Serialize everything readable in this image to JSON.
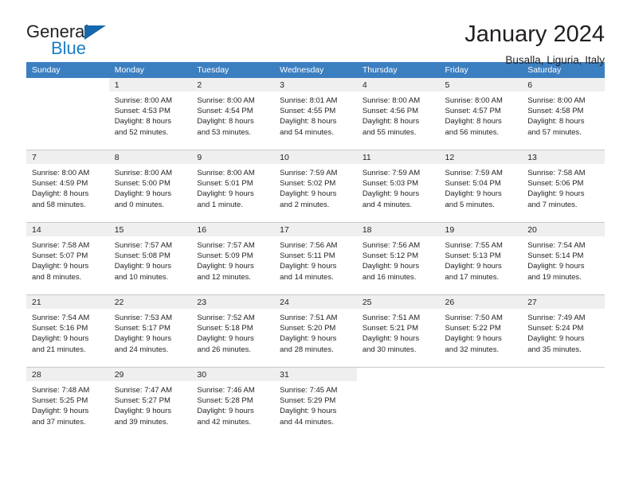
{
  "brand": {
    "name_top": "General",
    "name_bottom": "Blue",
    "triangle_color": "#1568ab",
    "blue_color": "#1b7fc4"
  },
  "header": {
    "title": "January 2024",
    "subtitle": "Busalla, Liguria, Italy"
  },
  "theme": {
    "header_row_bg": "#3c7fc0",
    "header_row_text": "#ffffff",
    "daynum_bg": "#efefef",
    "cell_border": "#c8c8c8",
    "text": "#231f20"
  },
  "weekdays": [
    "Sunday",
    "Monday",
    "Tuesday",
    "Wednesday",
    "Thursday",
    "Friday",
    "Saturday"
  ],
  "weeks": [
    [
      {
        "day": "",
        "sunrise": "",
        "sunset": "",
        "daylight1": "",
        "daylight2": "",
        "blank": true
      },
      {
        "day": "1",
        "sunrise": "Sunrise: 8:00 AM",
        "sunset": "Sunset: 4:53 PM",
        "daylight1": "Daylight: 8 hours",
        "daylight2": "and 52 minutes."
      },
      {
        "day": "2",
        "sunrise": "Sunrise: 8:00 AM",
        "sunset": "Sunset: 4:54 PM",
        "daylight1": "Daylight: 8 hours",
        "daylight2": "and 53 minutes."
      },
      {
        "day": "3",
        "sunrise": "Sunrise: 8:01 AM",
        "sunset": "Sunset: 4:55 PM",
        "daylight1": "Daylight: 8 hours",
        "daylight2": "and 54 minutes."
      },
      {
        "day": "4",
        "sunrise": "Sunrise: 8:00 AM",
        "sunset": "Sunset: 4:56 PM",
        "daylight1": "Daylight: 8 hours",
        "daylight2": "and 55 minutes."
      },
      {
        "day": "5",
        "sunrise": "Sunrise: 8:00 AM",
        "sunset": "Sunset: 4:57 PM",
        "daylight1": "Daylight: 8 hours",
        "daylight2": "and 56 minutes."
      },
      {
        "day": "6",
        "sunrise": "Sunrise: 8:00 AM",
        "sunset": "Sunset: 4:58 PM",
        "daylight1": "Daylight: 8 hours",
        "daylight2": "and 57 minutes."
      }
    ],
    [
      {
        "day": "7",
        "sunrise": "Sunrise: 8:00 AM",
        "sunset": "Sunset: 4:59 PM",
        "daylight1": "Daylight: 8 hours",
        "daylight2": "and 58 minutes."
      },
      {
        "day": "8",
        "sunrise": "Sunrise: 8:00 AM",
        "sunset": "Sunset: 5:00 PM",
        "daylight1": "Daylight: 9 hours",
        "daylight2": "and 0 minutes."
      },
      {
        "day": "9",
        "sunrise": "Sunrise: 8:00 AM",
        "sunset": "Sunset: 5:01 PM",
        "daylight1": "Daylight: 9 hours",
        "daylight2": "and 1 minute."
      },
      {
        "day": "10",
        "sunrise": "Sunrise: 7:59 AM",
        "sunset": "Sunset: 5:02 PM",
        "daylight1": "Daylight: 9 hours",
        "daylight2": "and 2 minutes."
      },
      {
        "day": "11",
        "sunrise": "Sunrise: 7:59 AM",
        "sunset": "Sunset: 5:03 PM",
        "daylight1": "Daylight: 9 hours",
        "daylight2": "and 4 minutes."
      },
      {
        "day": "12",
        "sunrise": "Sunrise: 7:59 AM",
        "sunset": "Sunset: 5:04 PM",
        "daylight1": "Daylight: 9 hours",
        "daylight2": "and 5 minutes."
      },
      {
        "day": "13",
        "sunrise": "Sunrise: 7:58 AM",
        "sunset": "Sunset: 5:06 PM",
        "daylight1": "Daylight: 9 hours",
        "daylight2": "and 7 minutes."
      }
    ],
    [
      {
        "day": "14",
        "sunrise": "Sunrise: 7:58 AM",
        "sunset": "Sunset: 5:07 PM",
        "daylight1": "Daylight: 9 hours",
        "daylight2": "and 8 minutes."
      },
      {
        "day": "15",
        "sunrise": "Sunrise: 7:57 AM",
        "sunset": "Sunset: 5:08 PM",
        "daylight1": "Daylight: 9 hours",
        "daylight2": "and 10 minutes."
      },
      {
        "day": "16",
        "sunrise": "Sunrise: 7:57 AM",
        "sunset": "Sunset: 5:09 PM",
        "daylight1": "Daylight: 9 hours",
        "daylight2": "and 12 minutes."
      },
      {
        "day": "17",
        "sunrise": "Sunrise: 7:56 AM",
        "sunset": "Sunset: 5:11 PM",
        "daylight1": "Daylight: 9 hours",
        "daylight2": "and 14 minutes."
      },
      {
        "day": "18",
        "sunrise": "Sunrise: 7:56 AM",
        "sunset": "Sunset: 5:12 PM",
        "daylight1": "Daylight: 9 hours",
        "daylight2": "and 16 minutes."
      },
      {
        "day": "19",
        "sunrise": "Sunrise: 7:55 AM",
        "sunset": "Sunset: 5:13 PM",
        "daylight1": "Daylight: 9 hours",
        "daylight2": "and 17 minutes."
      },
      {
        "day": "20",
        "sunrise": "Sunrise: 7:54 AM",
        "sunset": "Sunset: 5:14 PM",
        "daylight1": "Daylight: 9 hours",
        "daylight2": "and 19 minutes."
      }
    ],
    [
      {
        "day": "21",
        "sunrise": "Sunrise: 7:54 AM",
        "sunset": "Sunset: 5:16 PM",
        "daylight1": "Daylight: 9 hours",
        "daylight2": "and 21 minutes."
      },
      {
        "day": "22",
        "sunrise": "Sunrise: 7:53 AM",
        "sunset": "Sunset: 5:17 PM",
        "daylight1": "Daylight: 9 hours",
        "daylight2": "and 24 minutes."
      },
      {
        "day": "23",
        "sunrise": "Sunrise: 7:52 AM",
        "sunset": "Sunset: 5:18 PM",
        "daylight1": "Daylight: 9 hours",
        "daylight2": "and 26 minutes."
      },
      {
        "day": "24",
        "sunrise": "Sunrise: 7:51 AM",
        "sunset": "Sunset: 5:20 PM",
        "daylight1": "Daylight: 9 hours",
        "daylight2": "and 28 minutes."
      },
      {
        "day": "25",
        "sunrise": "Sunrise: 7:51 AM",
        "sunset": "Sunset: 5:21 PM",
        "daylight1": "Daylight: 9 hours",
        "daylight2": "and 30 minutes."
      },
      {
        "day": "26",
        "sunrise": "Sunrise: 7:50 AM",
        "sunset": "Sunset: 5:22 PM",
        "daylight1": "Daylight: 9 hours",
        "daylight2": "and 32 minutes."
      },
      {
        "day": "27",
        "sunrise": "Sunrise: 7:49 AM",
        "sunset": "Sunset: 5:24 PM",
        "daylight1": "Daylight: 9 hours",
        "daylight2": "and 35 minutes."
      }
    ],
    [
      {
        "day": "28",
        "sunrise": "Sunrise: 7:48 AM",
        "sunset": "Sunset: 5:25 PM",
        "daylight1": "Daylight: 9 hours",
        "daylight2": "and 37 minutes."
      },
      {
        "day": "29",
        "sunrise": "Sunrise: 7:47 AM",
        "sunset": "Sunset: 5:27 PM",
        "daylight1": "Daylight: 9 hours",
        "daylight2": "and 39 minutes."
      },
      {
        "day": "30",
        "sunrise": "Sunrise: 7:46 AM",
        "sunset": "Sunset: 5:28 PM",
        "daylight1": "Daylight: 9 hours",
        "daylight2": "and 42 minutes."
      },
      {
        "day": "31",
        "sunrise": "Sunrise: 7:45 AM",
        "sunset": "Sunset: 5:29 PM",
        "daylight1": "Daylight: 9 hours",
        "daylight2": "and 44 minutes."
      },
      {
        "day": "",
        "sunrise": "",
        "sunset": "",
        "daylight1": "",
        "daylight2": "",
        "blank": true
      },
      {
        "day": "",
        "sunrise": "",
        "sunset": "",
        "daylight1": "",
        "daylight2": "",
        "blank": true
      },
      {
        "day": "",
        "sunrise": "",
        "sunset": "",
        "daylight1": "",
        "daylight2": "",
        "blank": true
      }
    ]
  ]
}
